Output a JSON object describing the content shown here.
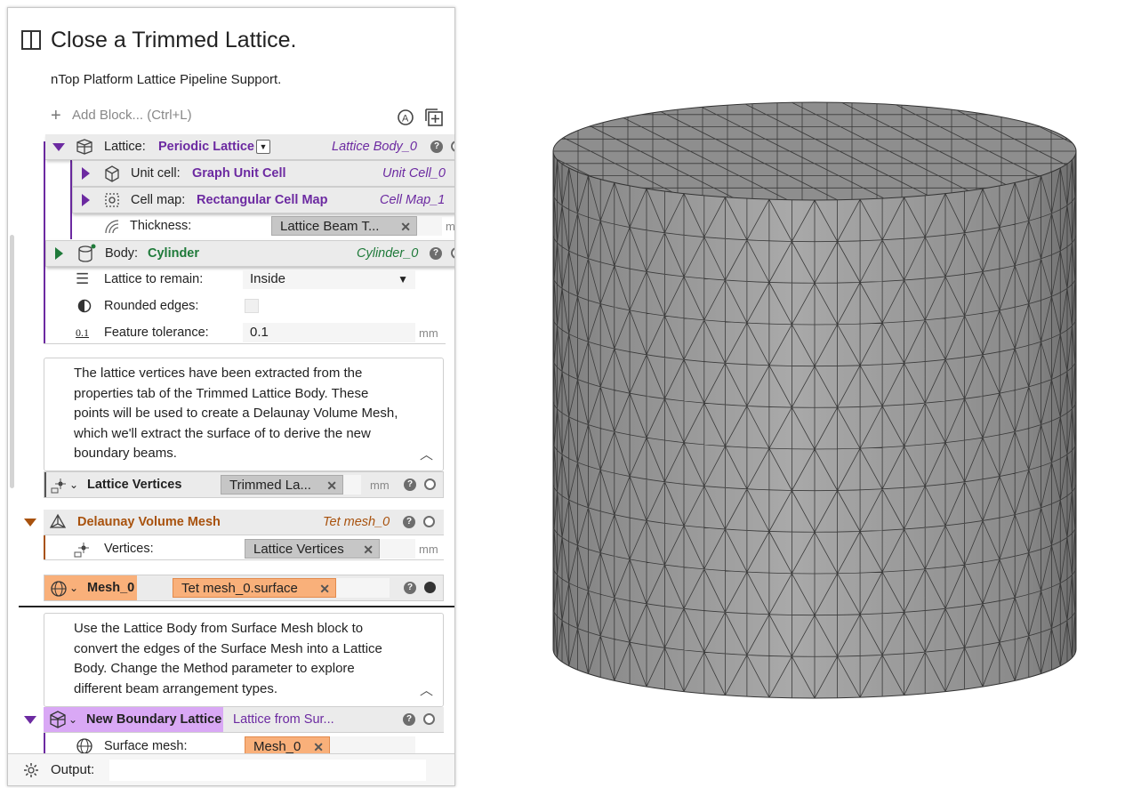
{
  "panel": {
    "title": "Close a Trimmed Lattice.",
    "subtitle": "nTop Platform Lattice Pipeline Support.",
    "add_block": "Add Block... (Ctrl+L)"
  },
  "blocks": {
    "lattice": {
      "label": "Lattice:",
      "type": "Periodic Lattice",
      "name": "Lattice Body_0"
    },
    "unit_cell": {
      "label": "Unit cell:",
      "type": "Graph Unit Cell",
      "name": "Unit Cell_0"
    },
    "cell_map": {
      "label": "Cell map:",
      "type": "Rectangular Cell Map",
      "name": "Cell Map_1"
    },
    "thickness": {
      "label": "Thickness:",
      "value": "Lattice Beam T...",
      "unit": "mm"
    },
    "body": {
      "label": "Body:",
      "type": "Cylinder",
      "name": "Cylinder_0"
    },
    "lattice_to_remain": {
      "label": "Lattice to remain:",
      "value": "Inside"
    },
    "rounded_edges": {
      "label": "Rounded edges:"
    },
    "feature_tolerance": {
      "label": "Feature tolerance:",
      "value": "0.1",
      "unit": "mm",
      "icon_text": "0.1"
    },
    "note1": "The lattice vertices have been extracted from the properties tab of the Trimmed Lattice Body. These points will be used to create a Delaunay Volume Mesh, which we'll extract the surface of to derive the new boundary beams.",
    "lattice_vertices": {
      "label": "Lattice Vertices",
      "value": "Trimmed La...",
      "unit": "mm"
    },
    "delaunay": {
      "label": "Delaunay Volume Mesh",
      "name": "Tet mesh_0"
    },
    "vertices": {
      "label": "Vertices:",
      "value": "Lattice Vertices",
      "unit": "mm"
    },
    "mesh0": {
      "label": "Mesh_0",
      "value": "Tet mesh_0.surface"
    },
    "note2": "Use the Lattice Body from Surface Mesh block to convert the edges of the Surface Mesh into a Lattice Body. Change the Method parameter to explore different beam arrangement types.",
    "boundary": {
      "label": "New Boundary Lattice",
      "name": "Lattice from Sur..."
    },
    "surface_mesh": {
      "label": "Surface mesh:",
      "value": "Mesh_0"
    },
    "output": {
      "label": "Output:"
    }
  },
  "colors": {
    "purple": "#6c2aa1",
    "green": "#1f7a3a",
    "brown": "#a8520e",
    "orange": "#f9b07a",
    "lilac": "#d9a8f5",
    "mesh_gray": "#9a9a9a"
  }
}
